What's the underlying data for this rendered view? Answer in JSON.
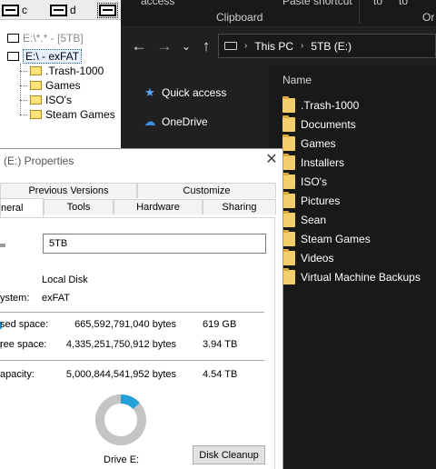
{
  "tree_window": {
    "drives": [
      {
        "letter": "c",
        "selected": false
      },
      {
        "letter": "d",
        "selected": false
      },
      {
        "letter": "",
        "selected": true
      }
    ],
    "header": "E:\\*.* - [5TB]",
    "root": "E:\\ - exFAT",
    "folders": [
      ".Trash-1000",
      "Games",
      "ISO's",
      "Steam Games"
    ]
  },
  "explorer": {
    "ribbon": {
      "item1": "access",
      "item2": "Paste shortcut",
      "item3": "to",
      "item4": "to",
      "item5": "Or",
      "group_label": "Clipboard"
    },
    "nav": {
      "back": "←",
      "forward": "→",
      "recent": "⌄",
      "up": "↑"
    },
    "address": {
      "crumbs": [
        "This PC",
        "5TB (E:)"
      ],
      "dropdown": "›"
    },
    "nav_pane": [
      {
        "label": "Quick access",
        "icon": "star-icon",
        "glyph": "★",
        "color": "#5aa8ff"
      },
      {
        "label": "OneDrive",
        "icon": "cloud-icon",
        "glyph": "☁",
        "color": "#3d8fe0"
      }
    ],
    "column_header": "Name",
    "files": [
      ".Trash-1000",
      "Documents",
      "Games",
      "Installers",
      "ISO's",
      "Pictures",
      "Sean",
      "Steam Games",
      "Videos",
      "Virtual Machine Backups"
    ]
  },
  "properties": {
    "title": "(E:) Properties",
    "close": "✕",
    "tabs_top": [
      "Previous Versions",
      "Customize"
    ],
    "tabs_bottom": [
      "neral",
      "Tools",
      "Hardware",
      "Sharing"
    ],
    "label_value": "5TB",
    "type_label": "",
    "type_value": "Local Disk",
    "fs_label": "ystem:",
    "fs_value": "exFAT",
    "used_label": "sed space:",
    "used_bytes": "665,592,791,040 bytes",
    "used_short": "619 GB",
    "free_label": "ree space:",
    "free_bytes": "4,335,251,750,912 bytes",
    "free_short": "3.94 TB",
    "capacity_label": "apacity:",
    "capacity_bytes": "5,000,844,541,952 bytes",
    "capacity_short": "4.54 TB",
    "used_fraction": 0.133,
    "used_color": "#26a0da",
    "free_color": "#c4c4c4",
    "drive_label": "Drive E:",
    "cleanup_label": "Disk Cleanup"
  }
}
